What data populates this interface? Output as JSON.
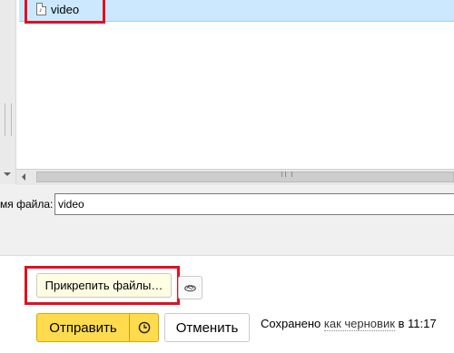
{
  "file_dialog": {
    "files": [
      {
        "name": "video",
        "selected": true
      }
    ],
    "filename_label": "мя файла:",
    "filename_value": "video"
  },
  "compose": {
    "attach_label": "Прикрепить файлы…",
    "disk_icon": "disk-icon",
    "send_label": "Отправить",
    "timer_icon": "clock-icon",
    "cancel_label": "Отменить",
    "status": {
      "prefix": "Сохранено",
      "link": "как черновик",
      "suffix": "в 11:17"
    }
  },
  "colors": {
    "selection": "#cce8ff",
    "highlight_border": "#e01020",
    "send_button": "#ffdb4d",
    "attach_button": "#fffde2"
  }
}
